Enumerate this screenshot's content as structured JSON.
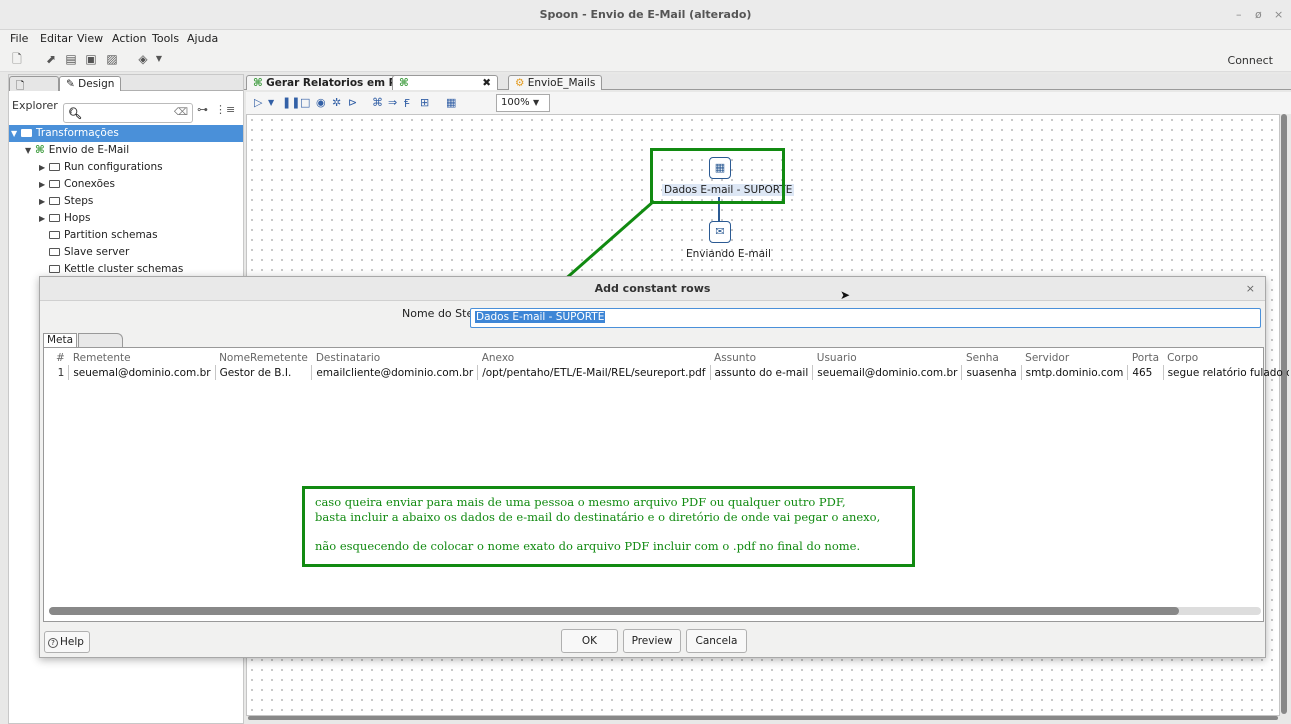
{
  "window": {
    "title": "Spoon - Envio de E-Mail (alterado)",
    "minimize": "–",
    "restore": "ø",
    "close": "×"
  },
  "menu": [
    "File",
    "Editar",
    "View",
    "Action",
    "Tools",
    "Ajuda"
  ],
  "toolbar": {
    "connect_label": "Connect",
    "icons": [
      "new-file-icon",
      "open-icon",
      "explore-icon",
      "save-icon",
      "save-as-icon",
      "layers-icon"
    ]
  },
  "left_panel": {
    "tabs": [
      "Design"
    ],
    "explorer_label": "Explorer",
    "search_placeholder": "",
    "tree": [
      {
        "label": "Transformações",
        "level": 0,
        "selected": true,
        "expanded": true,
        "type": "folder"
      },
      {
        "label": "Envio de E-Mail",
        "level": 1,
        "expanded": true,
        "type": "transformation"
      },
      {
        "label": "Run configurations",
        "level": 2,
        "type": "folder",
        "collapsible": true
      },
      {
        "label": "Conexões",
        "level": 2,
        "type": "folder",
        "collapsible": true
      },
      {
        "label": "Steps",
        "level": 2,
        "type": "folder",
        "collapsible": true
      },
      {
        "label": "Hops",
        "level": 2,
        "type": "folder",
        "collapsible": true
      },
      {
        "label": "Partition schemas",
        "level": 2,
        "type": "folder",
        "collapsible": false
      },
      {
        "label": "Slave server",
        "level": 2,
        "type": "folder",
        "collapsible": false
      },
      {
        "label": "Kettle cluster schemas",
        "level": 2,
        "type": "folder",
        "collapsible": false
      }
    ]
  },
  "file_tabs": [
    {
      "label": "Gerar Relatorios em PDF",
      "bold": true
    },
    {
      "label": "",
      "active": true
    },
    {
      "label": "EnvioE_Mails"
    }
  ],
  "canvas": {
    "zoom": "100%",
    "steps": [
      {
        "label": "Dados E-mail - SUPORTE",
        "icon": "data-grid-icon"
      },
      {
        "label": "Enviando E-mail",
        "icon": "mail-icon"
      }
    ]
  },
  "dialog": {
    "title": "Add constant rows",
    "close": "×",
    "step_name_label": "Nome do Step",
    "step_name_value": "Dados E-mail - SUPORTE",
    "tab": "Meta",
    "columns": [
      "#",
      "Remetente",
      "NomeRemetente",
      "Destinatario",
      "Anexo",
      "Assunto",
      "Usuario",
      "Senha",
      "Servidor",
      "Porta",
      "Corpo"
    ],
    "rows": [
      [
        "1",
        "seuemal@dominio.com.br",
        "Gestor de B.I.",
        "emailcliente@dominio.com.br",
        "/opt/pentaho/ETL/E-Mail/REL/seureport.pdf",
        "assunto do e-mail",
        "seuemail@dominio.com.br",
        "suasenha",
        "smtp.dominio.com",
        "465",
        "segue relatório fulado de t"
      ]
    ],
    "buttons": {
      "help": "Help",
      "ok": "OK",
      "preview": "Preview",
      "cancel": "Cancela"
    }
  },
  "annotation": {
    "line1": "caso queira enviar para mais de uma pessoa o mesmo arquivo PDF ou qualquer outro PDF,",
    "line2": "basta incluir a abaixo os dados de e-mail do destinatário e o diretório de onde vai pegar o anexo,",
    "line3": "não esquecendo de colocar o nome exato do arquivo PDF incluir com o .pdf no final do nome."
  },
  "colors": {
    "annotation_green": "#118a11",
    "selection_blue": "#4a90d9",
    "step_border": "#2b5a93"
  }
}
